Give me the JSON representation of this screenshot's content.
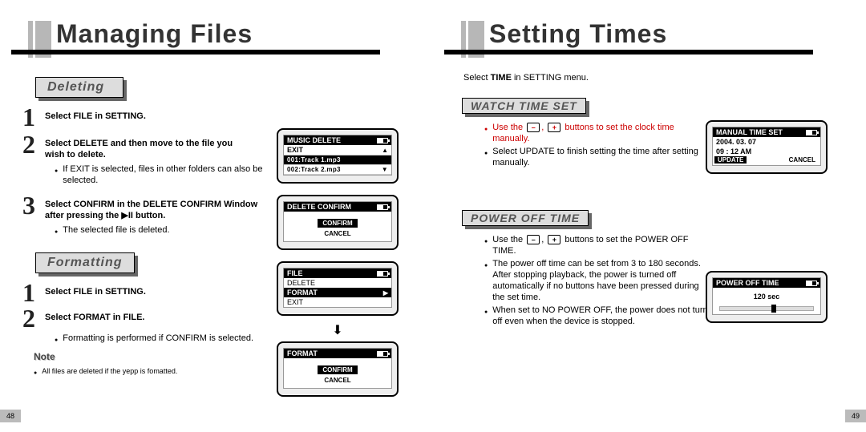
{
  "left": {
    "title": "Managing Files",
    "pageNum": "48",
    "deleting": {
      "tab": "Deleting",
      "step1": "Select FILE in SETTING.",
      "step2a": "Select DELETE and then move to the file you",
      "step2b": "wish to delete.",
      "step2_bullet": "If EXIT is selected, files in other folders can also be selected.",
      "step3a": "Select CONFIRM in the DELETE CONFIRM Window",
      "step3b": "after pressing the ▶II button.",
      "step3_bullet": "The selected file is deleted."
    },
    "formatting": {
      "tab": "Formatting",
      "step1": "Select FILE in SETTING.",
      "step2": "Select FORMAT in FILE.",
      "step2_bullet": "Formatting is performed if CONFIRM is selected.",
      "note": "Note",
      "note_bullet": "All files are deleted if the yepp is fomatted."
    },
    "lcd1": {
      "title": "MUSIC DELETE",
      "r1": "EXIT",
      "r2": "001:Track 1.mp3",
      "r3": "002:Track 2.mp3"
    },
    "lcd2": {
      "title": "DELETE CONFIRM",
      "confirm": "CONFIRM",
      "cancel": "CANCEL"
    },
    "lcd3": {
      "title": "FILE",
      "r1": "DELETE",
      "r2": "FORMAT",
      "r3": "EXIT"
    },
    "lcd4": {
      "title": "FORMAT",
      "confirm": "CONFIRM",
      "cancel": "CANCEL"
    }
  },
  "right": {
    "title": "Setting Times",
    "pageNum": "49",
    "intro_a": "Select ",
    "intro_b": "TIME",
    "intro_c": " in SETTING menu.",
    "watch": {
      "tab": "WATCH TIME SET",
      "b1a": "Use the ",
      "b1b": " buttons to set the clock time manually.",
      "b2": "Select UPDATE to finish setting the time after setting manually."
    },
    "power": {
      "tab": "POWER OFF TIME",
      "b1a": "Use the ",
      "b1b": " buttons to set the POWER OFF TIME.",
      "b2": "The power off time can be set from 3 to 180 seconds. After stopping playback, the power is turned off automatically if no buttons have been pressed during the set time.",
      "b3": "When set to NO POWER OFF, the power does not turn off even when the device is stopped."
    },
    "lcdA": {
      "title": "MANUAL TIME SET",
      "date": "2004. 03. 07",
      "time": "09 : 12 AM",
      "update": "UPDATE",
      "cancel": "CANCEL"
    },
    "lcdB": {
      "title": "POWER OFF TIME",
      "val": "120 sec"
    },
    "icons": {
      "minus": "–",
      "plus": "+",
      "comma": ","
    }
  }
}
